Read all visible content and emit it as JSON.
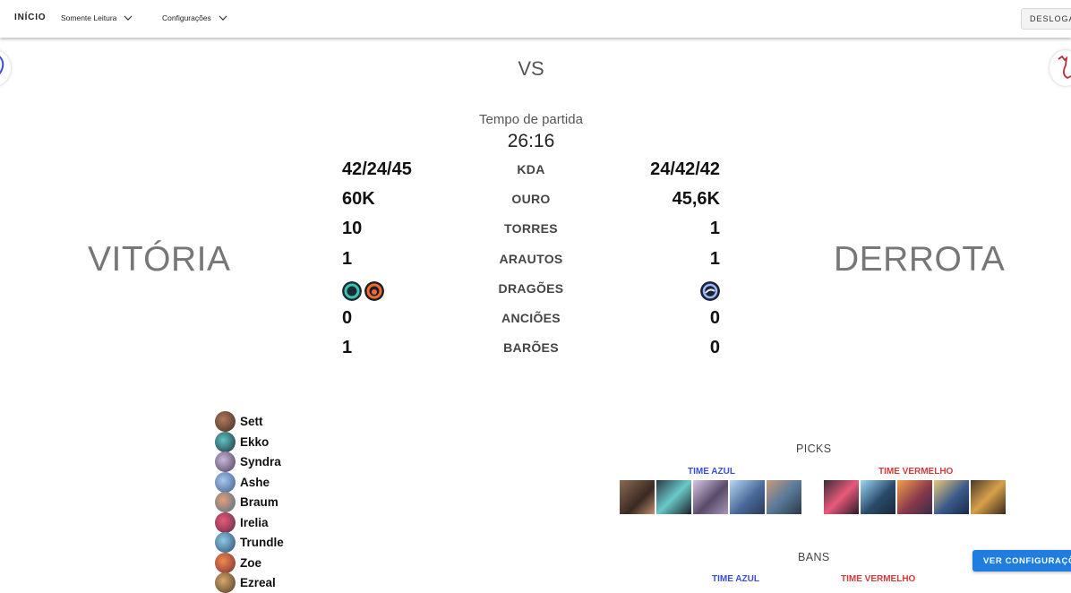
{
  "nav": {
    "home": "INÍCIO",
    "menu1": "Somente Leitura",
    "menu2": "Configurações",
    "logout": "DESLOGAR"
  },
  "match": {
    "vs": "VS",
    "time_label": "Tempo de partida",
    "time_value": "26:16",
    "result_left": "VITÓRIA",
    "result_right": "DERROTA"
  },
  "stats": [
    {
      "label": "KDA",
      "left": "42/24/45",
      "right": "24/42/42"
    },
    {
      "label": "OURO",
      "left": "60K",
      "right": "45,6K"
    },
    {
      "label": "TORRES",
      "left": "10",
      "right": "1"
    },
    {
      "label": "ARAUTOS",
      "left": "1",
      "right": "1"
    },
    {
      "label": "DRAGÕES",
      "left": "",
      "right": ""
    },
    {
      "label": "ANCIÕES",
      "left": "0",
      "right": "0"
    },
    {
      "label": "BARÕES",
      "left": "1",
      "right": "0"
    }
  ],
  "dragons": {
    "left": [
      "ocean-dragon-icon",
      "infernal-dragon-icon"
    ],
    "right": [
      "cloud-dragon-icon"
    ]
  },
  "roster": [
    "Sett",
    "Ekko",
    "Syndra",
    "Ashe",
    "Braum",
    "Irelia",
    "Trundle",
    "Zoe",
    "Ezreal"
  ],
  "picks": {
    "title": "PICKS",
    "blue_label": "TIME AZUL",
    "red_label": "TIME VERMELHO"
  },
  "bans": {
    "title": "BANS",
    "blue_label": "TIME AZUL",
    "red_label": "TIME VERMELHO"
  },
  "config_button": "VER CONFIGURAÇÕES",
  "colors": {
    "blue_team": "#3a4fd8",
    "red_team": "#d33b3b",
    "primary_button": "#1f7de0"
  }
}
